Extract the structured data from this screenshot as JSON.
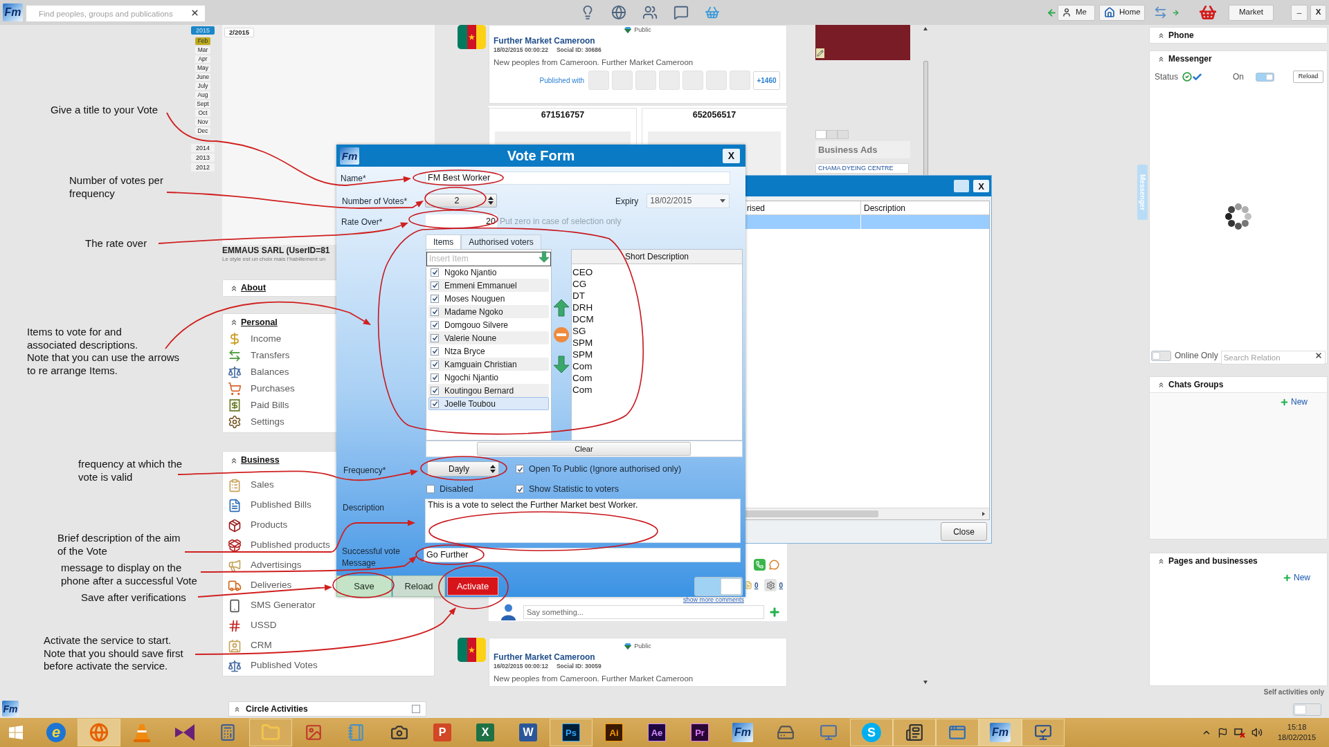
{
  "top_bar": {
    "logo": "Fm",
    "search": {
      "placeholder": "Find peoples, groups and publications"
    },
    "me": "Me",
    "home": "Home",
    "market": "Market",
    "minimize": "_",
    "close": "X"
  },
  "calendar": {
    "badge": "2/2015",
    "years": [
      {
        "label": "2015",
        "selected": true,
        "months": [
          {
            "label": "Feb",
            "selected": true
          },
          {
            "label": "Mar",
            "selected": false
          },
          {
            "label": "Apr",
            "selected": false
          },
          {
            "label": "May",
            "selected": false
          },
          {
            "label": "June",
            "selected": false
          },
          {
            "label": "July",
            "selected": false
          },
          {
            "label": "Aug",
            "selected": false
          },
          {
            "label": "Sept",
            "selected": false
          },
          {
            "label": "Oct",
            "selected": false
          },
          {
            "label": "Nov",
            "selected": false
          },
          {
            "label": "Dec",
            "selected": false
          }
        ]
      },
      {
        "label": "2014",
        "selected": false
      },
      {
        "label": "2013",
        "selected": false
      },
      {
        "label": "2012",
        "selected": false
      }
    ]
  },
  "profile": {
    "name": "EMMAUS SARL (UserID=81",
    "tagline": "Le style est un choix mais l'habillement un"
  },
  "menu": [
    {
      "title": "About"
    },
    {
      "title": "Personal",
      "items": [
        "Income",
        "Transfers",
        "Balances",
        "Purchases",
        "Paid Bills",
        "Settings"
      ]
    },
    {
      "title": "Business",
      "items": [
        "Sales",
        "Published Bills",
        "Products",
        "Published products",
        "Advertisings",
        "Deliveries",
        "SMS Generator",
        "USSD",
        "CRM",
        "Published Votes"
      ]
    }
  ],
  "circle_activities": {
    "title": "Circle Activities",
    "checked": false
  },
  "footer_logo": "Fm",
  "feed": {
    "top_post": {
      "visibility": "Public",
      "author": "Further Market Cameroon",
      "date": "18/02/2015 00:00:22",
      "social_id": "Social ID: 30686",
      "text": "New peoples from Cameroon. Further Market Cameroon",
      "published_with": "Published with",
      "more": "+1460"
    },
    "cards": [
      "671516757",
      "652056517"
    ],
    "counts": [
      "0",
      "0"
    ],
    "show_more": "show more comments",
    "comment": {
      "placeholder": "Say something..."
    },
    "bottom_post": {
      "visibility": "Public",
      "author": "Further Market Cameroon",
      "date": "16/02/2015 00:00:12",
      "social_id": "Social ID: 30059",
      "text": "New peoples from Cameroon. Further Market Cameroon"
    }
  },
  "ads": {
    "pages": [
      {
        "selected": true
      },
      {
        "selected": false
      },
      {
        "selected": false
      }
    ],
    "title": "Business Ads",
    "items": [
      "CHAMA DYEING CENTRE"
    ]
  },
  "messenger_tab": "Messenger",
  "right_panel": {
    "phone": "Phone",
    "messenger": {
      "title": "Messenger",
      "status": "Status",
      "online": {
        "label": "On",
        "on": true
      },
      "reload": "Reload",
      "online_only": {
        "label": "Online Only",
        "on": false
      },
      "search": {
        "placeholder": "Search Relation"
      }
    },
    "chats_groups": {
      "title": "Chats Groups",
      "new": "New"
    },
    "pages": {
      "title": "Pages and businesses",
      "new": "New"
    },
    "self_activities": {
      "label": "Self activities only",
      "on": false
    }
  },
  "list_window": {
    "close": "X",
    "columns": [
      "rised",
      "Description"
    ],
    "rows": [
      {
        "selected": true
      }
    ],
    "close_button": "Close"
  },
  "vote_form": {
    "logo": "Fm",
    "title": "Vote Form",
    "close": "X",
    "name": {
      "label": "Name*",
      "value": "FM Best Worker"
    },
    "votes": {
      "label": "Number of Votes*",
      "value": "2"
    },
    "expiry": {
      "label": "Expiry",
      "value": "18/02/2015"
    },
    "rate": {
      "label": "Rate Over*",
      "value": "20",
      "hint": "Put zero in case of selection only"
    },
    "tabs": [
      {
        "label": "Items",
        "selected": true
      },
      {
        "label": "Authorised voters",
        "selected": false
      }
    ],
    "insert": {
      "placeholder": "Insert Item"
    },
    "description_header": "Short Description",
    "items": [
      {
        "name": "Ngoko Njantio",
        "checked": true,
        "selected": false,
        "description": "CEO"
      },
      {
        "name": "Emmeni Emmanuel",
        "checked": true,
        "selected": false,
        "description": "CG"
      },
      {
        "name": "Moses Nouguen",
        "checked": true,
        "selected": false,
        "description": "DT"
      },
      {
        "name": "Madame Ngoko",
        "checked": true,
        "selected": false,
        "description": "DRH"
      },
      {
        "name": "Domgouo Silvere",
        "checked": true,
        "selected": false,
        "description": "DCM"
      },
      {
        "name": "Valerie Noune",
        "checked": true,
        "selected": false,
        "description": "SG"
      },
      {
        "name": "Ntza Bryce",
        "checked": true,
        "selected": false,
        "description": "SPM"
      },
      {
        "name": "Kamguain Christian",
        "checked": true,
        "selected": false,
        "description": "SPM"
      },
      {
        "name": "Ngochi Njantio",
        "checked": true,
        "selected": false,
        "description": "Com"
      },
      {
        "name": "Koutingou Bernard",
        "checked": true,
        "selected": false,
        "description": "Com"
      },
      {
        "name": "Joelle Toubou",
        "checked": true,
        "selected": true,
        "description": "Com"
      }
    ],
    "clear": "Clear",
    "frequency": {
      "label": "Frequency*",
      "value": "Dayly"
    },
    "options": [
      {
        "label": "Open To Public (Ignore authorised only)",
        "checked": true
      },
      {
        "label": "Disabled",
        "checked": false
      },
      {
        "label": "Show Statistic to voters",
        "checked": true
      }
    ],
    "description": {
      "label": "Description",
      "value": "This is a vote to select the Further Market best Worker."
    },
    "message": {
      "label": "Successful vote Message",
      "value": "Go Further"
    },
    "buttons": [
      {
        "label": "Save",
        "kind": "save"
      },
      {
        "label": "Reload",
        "kind": "reload"
      },
      {
        "label": "Activate",
        "kind": "activate"
      }
    ],
    "toggle": {
      "on": true
    }
  },
  "annotations": [
    "Give a title to your Vote",
    "Number of votes per\nfrequency",
    "The rate over",
    "Items to vote for and\nassociated descriptions.\nNote that you can use the arrows\nto re arrange Items.",
    "frequency at which the\nvote is valid",
    "Brief description of the aim\nof the Vote",
    "message to display on the\nphone after a successful Vote",
    "Save after verifications",
    "Activate the service to start.\nNote that you should save first\nbefore activate the service."
  ],
  "taskbar": {
    "apps": [
      {
        "kind": "windows",
        "running": false,
        "active": false
      },
      {
        "kind": "ie",
        "label": "e",
        "running": false,
        "active": false
      },
      {
        "kind": "firefox",
        "running": true,
        "active": true
      },
      {
        "kind": "vlc",
        "running": false,
        "active": false
      },
      {
        "kind": "vs",
        "running": false,
        "active": false
      },
      {
        "kind": "calculator",
        "running": false,
        "active": false
      },
      {
        "kind": "folder",
        "running": true,
        "active": false
      },
      {
        "kind": "paint",
        "running": false,
        "active": false
      },
      {
        "kind": "notes",
        "running": false,
        "active": false
      },
      {
        "kind": "camera",
        "running": false,
        "active": false
      },
      {
        "kind": "powerpoint",
        "label": "P",
        "running": false,
        "active": false
      },
      {
        "kind": "excel",
        "label": "X",
        "running": false,
        "active": false
      },
      {
        "kind": "word",
        "label": "W",
        "running": false,
        "active": false
      },
      {
        "kind": "photoshop",
        "label": "Ps",
        "running": true,
        "active": false
      },
      {
        "kind": "illustrator",
        "label": "Ai",
        "running": false,
        "active": false
      },
      {
        "kind": "aftereffects",
        "label": "Ae",
        "running": false,
        "active": false
      },
      {
        "kind": "premiere",
        "label": "Pr",
        "running": false,
        "active": false
      },
      {
        "kind": "fm",
        "label": "Fm",
        "running": false,
        "active": false
      },
      {
        "kind": "drive",
        "running": false,
        "active": false
      },
      {
        "kind": "monitor",
        "running": false,
        "active": false
      },
      {
        "kind": "skype",
        "label": "S",
        "running": true,
        "active": false
      },
      {
        "kind": "reader",
        "running": true,
        "active": false
      },
      {
        "kind": "remote",
        "running": true,
        "active": false
      },
      {
        "kind": "fm",
        "label": "Fm",
        "running": true,
        "active": true
      },
      {
        "kind": "screen",
        "running": true,
        "active": false
      }
    ],
    "clock": {
      "time": "15:18",
      "date": "18/02/2015"
    }
  }
}
